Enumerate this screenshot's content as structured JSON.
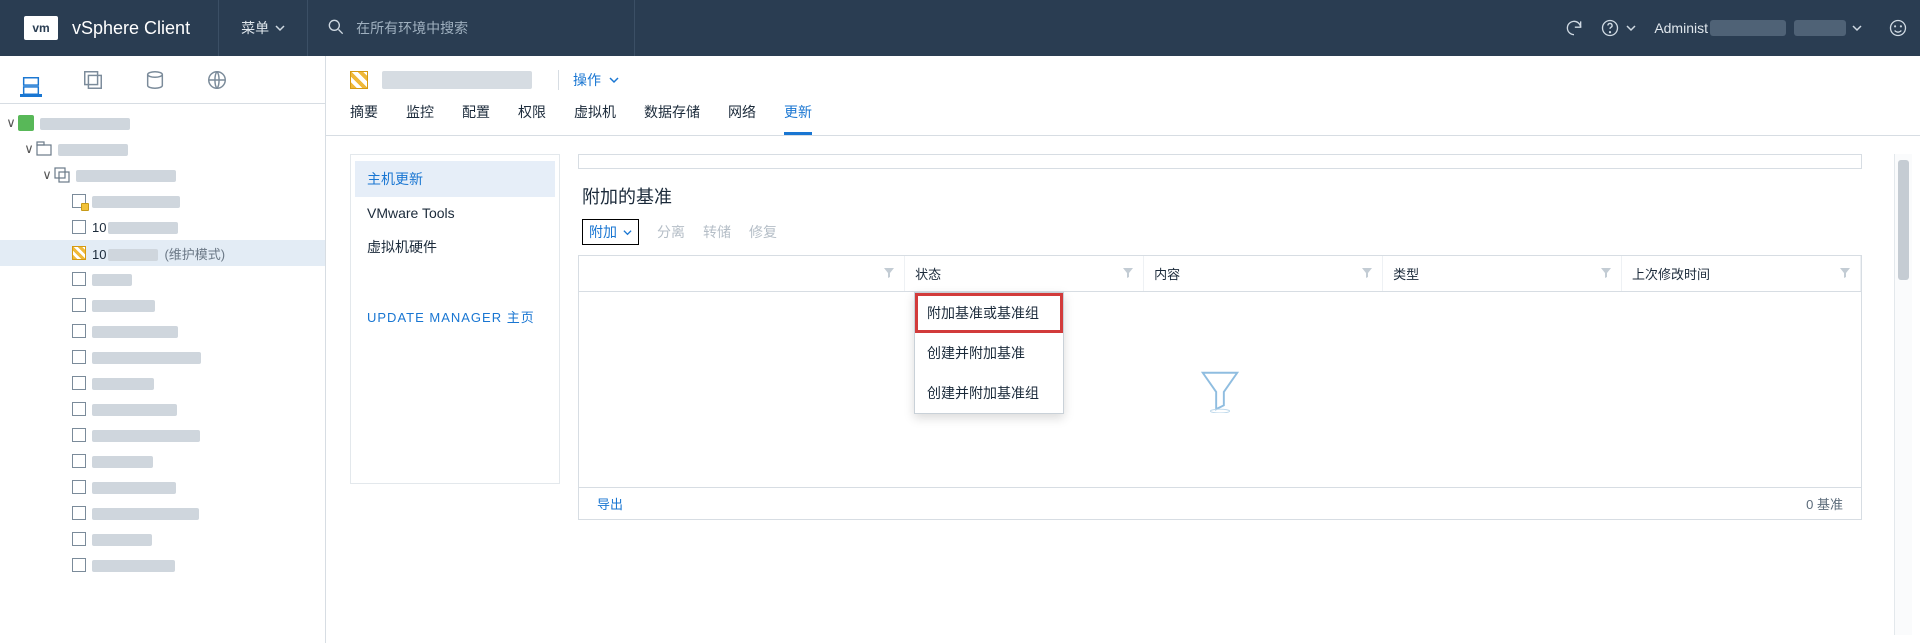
{
  "header": {
    "logo": "vm",
    "title": "vSphere Client",
    "menu_label": "菜单",
    "search_placeholder": "在所有环境中搜索",
    "user_prefix": "Administ"
  },
  "sidebar_tabs": [
    "hosts-clusters",
    "vms-templates",
    "storage",
    "networking"
  ],
  "tree": {
    "root_label_blur_w": 90,
    "dc_label_blur_w": 70,
    "cluster_label_blur_w": 100,
    "host_warn_prefix": "",
    "host2_prefix": "10",
    "host_sel_prefix": "10",
    "maint_mode": "(维护模式)",
    "extra_hosts_count": 12
  },
  "content": {
    "actions_label": "操作",
    "tabs": [
      "摘要",
      "监控",
      "配置",
      "权限",
      "虚拟机",
      "数据存储",
      "网络",
      "更新"
    ],
    "active_tab_index": 7
  },
  "left_panel": {
    "items": [
      "主机更新",
      "VMware Tools",
      "虚拟机硬件"
    ],
    "active_index": 0,
    "link": "UPDATE MANAGER 主页"
  },
  "right_panel": {
    "title": "附加的基准",
    "toolbar": {
      "attach": "附加",
      "detach": "分离",
      "transfer": "转储",
      "remediate": "修复"
    },
    "columns": [
      "",
      "状态",
      "内容",
      "类型",
      "上次修改时间"
    ],
    "footer": {
      "export": "导出",
      "count": "0 基准"
    }
  },
  "dropdown": {
    "items": [
      "附加基准或基准组",
      "创建并附加基准",
      "创建并附加基准组"
    ],
    "highlight_index": 0
  }
}
